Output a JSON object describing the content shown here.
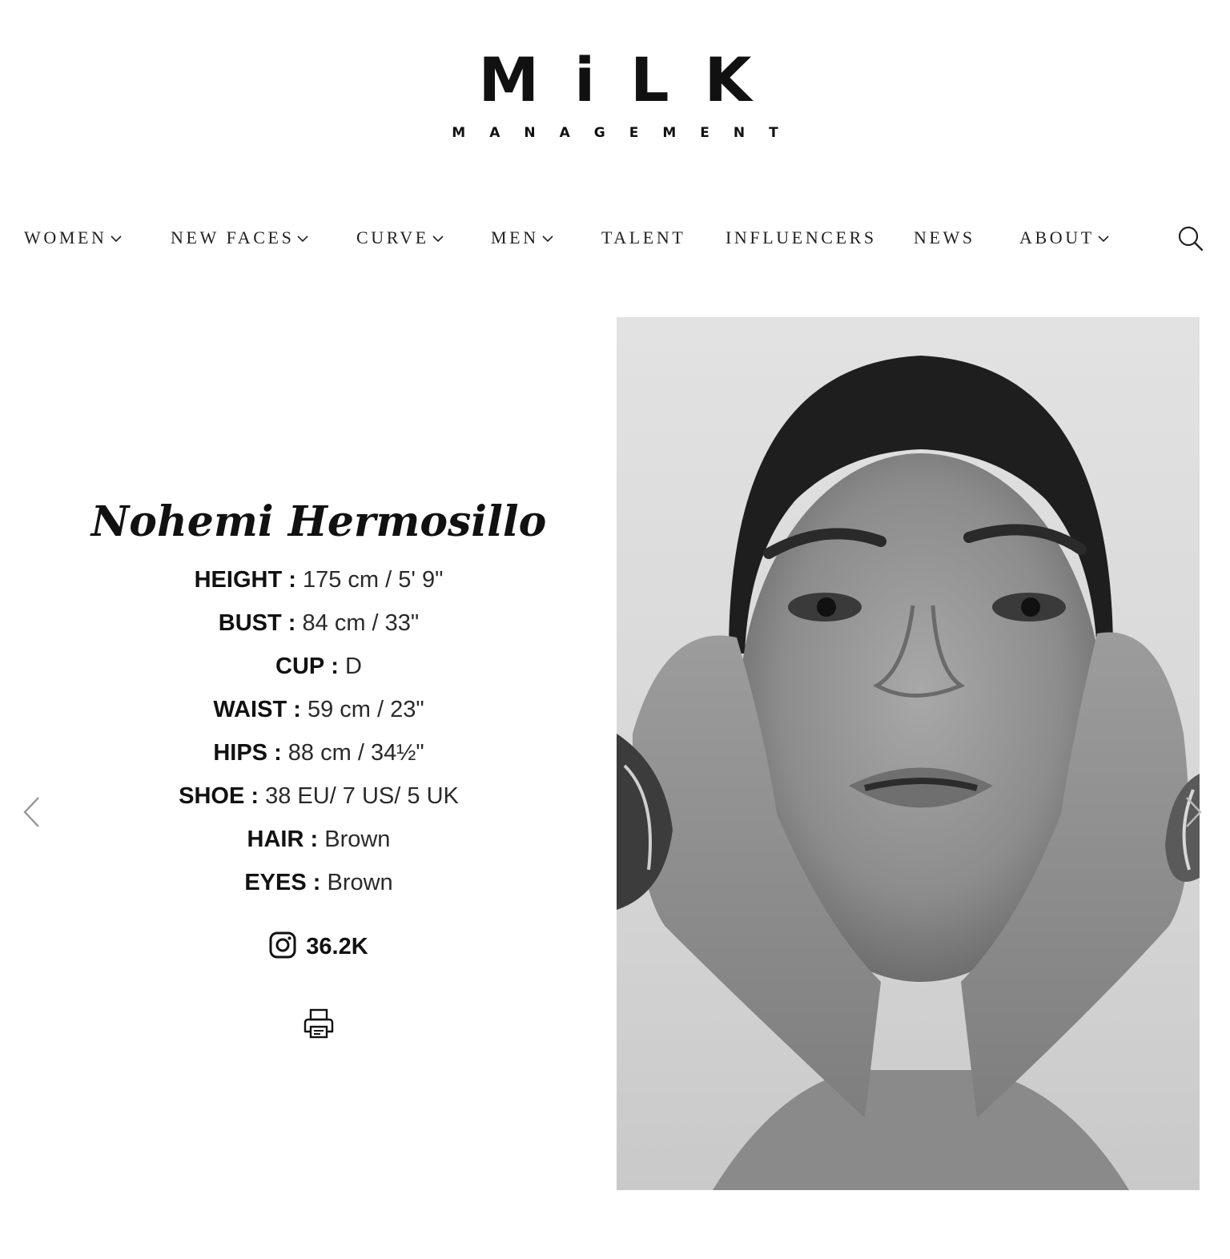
{
  "brand": {
    "logo_main": "MiLK",
    "logo_sub": "MANAGEMENT"
  },
  "nav": {
    "items": [
      {
        "label": "WOMEN",
        "dropdown": true
      },
      {
        "label": "NEW FACES",
        "dropdown": true
      },
      {
        "label": "CURVE",
        "dropdown": true
      },
      {
        "label": "MEN",
        "dropdown": true
      },
      {
        "label": "TALENT",
        "dropdown": false
      },
      {
        "label": "INFLUENCERS",
        "dropdown": false
      },
      {
        "label": "NEWS",
        "dropdown": false
      },
      {
        "label": "ABOUT",
        "dropdown": true
      }
    ],
    "search_icon": "search-icon"
  },
  "model": {
    "name": "Nohemi Hermosillo",
    "stats": [
      {
        "label": "HEIGHT",
        "value": "175 cm / 5' 9\""
      },
      {
        "label": "BUST",
        "value": "84 cm / 33\""
      },
      {
        "label": "CUP",
        "value": "D"
      },
      {
        "label": "WAIST",
        "value": "59 cm / 23\""
      },
      {
        "label": "HIPS",
        "value": "88 cm / 34½\""
      },
      {
        "label": "SHOE",
        "value": "38 EU/ 7 US/ 5 UK"
      },
      {
        "label": "HAIR",
        "value": "Brown"
      },
      {
        "label": "EYES",
        "value": "Brown"
      }
    ],
    "separator": ":",
    "instagram_followers": "36.2K",
    "instagram_icon": "instagram-icon",
    "print_icon": "printer-icon"
  },
  "gallery": {
    "prev_icon": "chevron-left-icon",
    "next_icon": "chevron-right-icon",
    "photo": "black-and-white-portrait"
  },
  "colors": {
    "text": "#111111",
    "nav_text": "#222222",
    "background": "#ffffff",
    "icon_gray": "#9a9a9a"
  }
}
